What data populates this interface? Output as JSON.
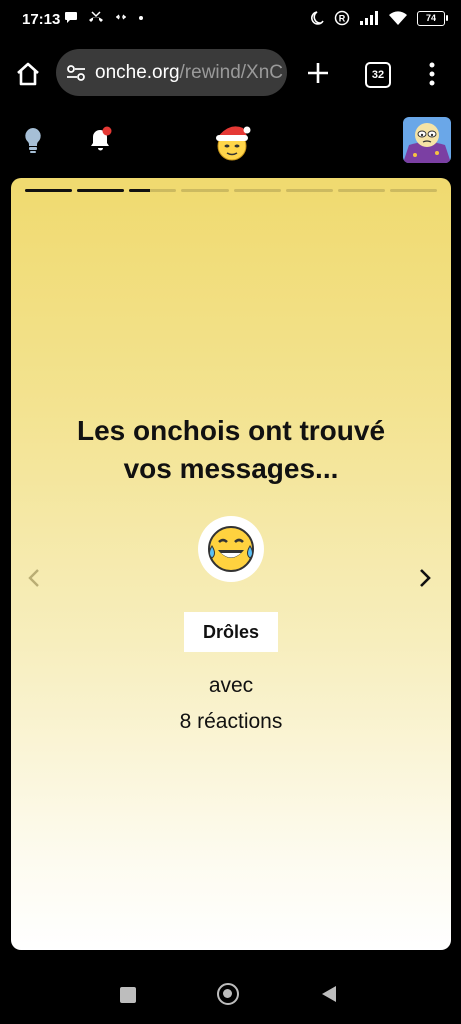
{
  "status_bar": {
    "time": "17:13",
    "battery": "74"
  },
  "browser": {
    "url_host": "onche.org",
    "url_path": "/rewind/XnC",
    "tab_count": "32"
  },
  "story": {
    "progress": {
      "total_segments": 8,
      "completed_segments": 2,
      "current_segment_fraction": 0.45
    },
    "headline_line1": "Les onchois ont trouvé",
    "headline_line2": "vos messages...",
    "reaction_emoji": "laughing-with-tears-emoji",
    "reaction_label": "Drôles",
    "avec_label": "avec",
    "reaction_count": "8 réactions"
  },
  "colors": {
    "card_top": "#f0da6f",
    "card_bottom": "#ffffff",
    "notification_dot": "#e53935"
  }
}
